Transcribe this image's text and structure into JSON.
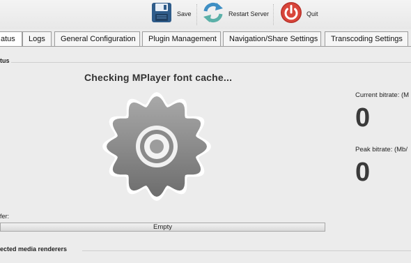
{
  "toolbar": {
    "save_label": "Save",
    "restart_label": "Restart Server",
    "quit_label": "Quit"
  },
  "tabs": [
    {
      "label": "atus"
    },
    {
      "label": "Logs"
    },
    {
      "label": "General Configuration"
    },
    {
      "label": "Plugin Management"
    },
    {
      "label": "Navigation/Share Settings"
    },
    {
      "label": "Transcoding Settings"
    }
  ],
  "status": {
    "section_title": "tus",
    "message": "Checking MPlayer font cache..."
  },
  "bitrate": {
    "current_label": "Current bitrate: (M",
    "current_value": "0",
    "peak_label": "Peak bitrate: (Mb/",
    "peak_value": "0"
  },
  "buffer": {
    "label": "fer:",
    "progress_text": "Empty",
    "progress_fraction": 0
  },
  "renderers": {
    "section_title": "ected media renderers"
  },
  "icons": {
    "save": "floppy-disk-icon",
    "restart": "refresh-arrows-icon",
    "quit": "power-icon",
    "status": "gear-icon"
  }
}
